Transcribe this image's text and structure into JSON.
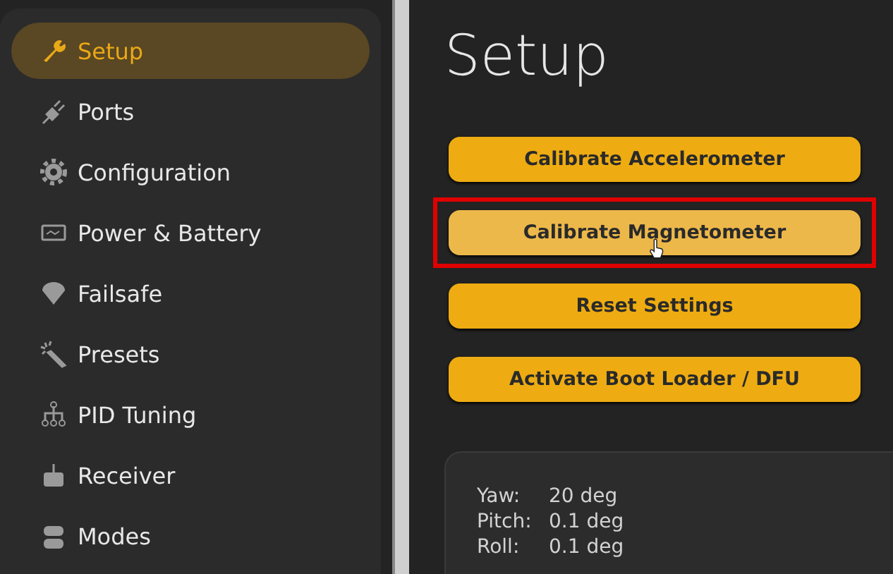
{
  "sidebar": {
    "items": [
      {
        "label": "Setup",
        "selected": true
      },
      {
        "label": "Ports",
        "selected": false
      },
      {
        "label": "Configuration",
        "selected": false
      },
      {
        "label": "Power & Battery",
        "selected": false
      },
      {
        "label": "Failsafe",
        "selected": false
      },
      {
        "label": "Presets",
        "selected": false
      },
      {
        "label": "PID Tuning",
        "selected": false
      },
      {
        "label": "Receiver",
        "selected": false
      },
      {
        "label": "Modes",
        "selected": false
      }
    ]
  },
  "page": {
    "title": "Setup",
    "buttons": [
      {
        "label": "Calibrate Accelerometer",
        "highlighted": false,
        "hovered": false
      },
      {
        "label": "Calibrate Magnetometer",
        "highlighted": true,
        "hovered": true
      },
      {
        "label": "Reset Settings",
        "highlighted": false,
        "hovered": false
      },
      {
        "label": "Activate Boot Loader / DFU",
        "highlighted": false,
        "hovered": false
      }
    ],
    "attitude": [
      {
        "label": "Yaw:",
        "value": "20 deg"
      },
      {
        "label": "Pitch:",
        "value": "0.1 deg"
      },
      {
        "label": "Roll:",
        "value": "0.1 deg"
      }
    ]
  }
}
